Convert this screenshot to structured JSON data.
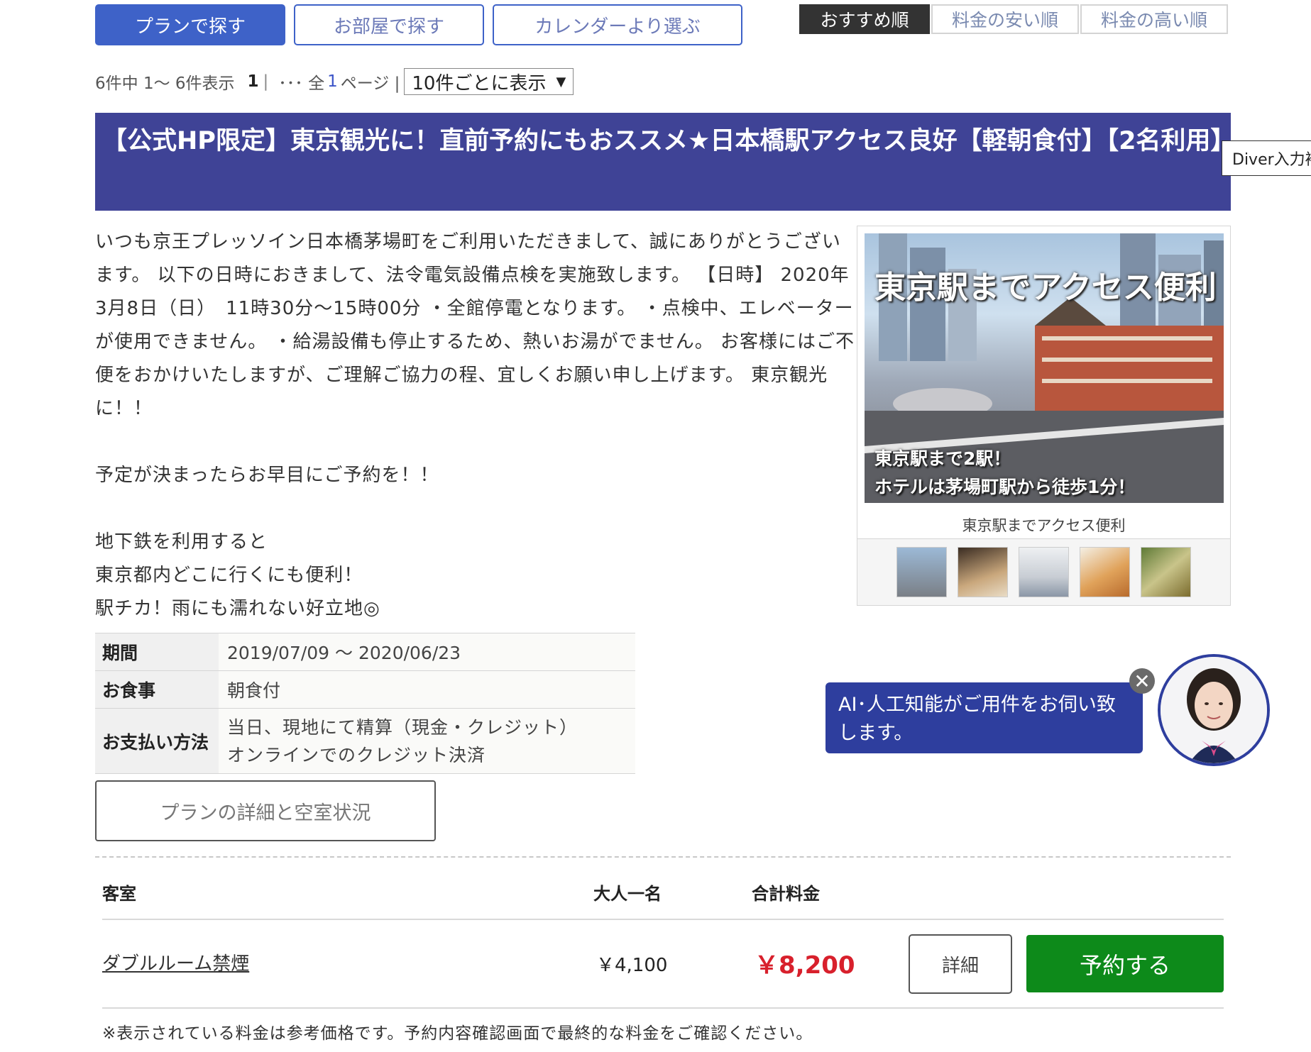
{
  "search_tabs": {
    "plan": "プランで探す",
    "room": "お部屋で探す",
    "calendar": "カレンダーより選ぶ"
  },
  "sort_tabs": {
    "recommended": "おすすめ順",
    "cheap": "料金の安い順",
    "expensive": "料金の高い順"
  },
  "pager": {
    "summary": "6件中 1〜 6件表示",
    "current_page": "1",
    "separator": "|",
    "ellipsis": "･･･ 全",
    "total_pages": "1",
    "page_suffix": "ページ |",
    "per_page": "10件ごとに表示"
  },
  "plan": {
    "title": "【公式HP限定】東京観光に！直前予約にもおススメ★日本橋駅アクセス良好【軽朝食付】【2名利用】",
    "description": [
      "いつも京王プレッソイン日本橋茅場町をご利用いただきまして、誠にありがとうございます。 以下の日時におきまして、法令電気設備点検を実施致します。 【日時】 2020年3月8日（日）　11時30分〜15時00分 ・全館停電となります。 ・点検中、エレベーターが使用できません。 ・給湯設備も停止するため、熱いお湯がでません。 お客様にはご不便をおかけいたしますが、ご理解ご協力の程、宜しくお願い申し上げます。 東京観光に！！",
      "予定が決まったらお早目にご予約を！！",
      "地下鉄を利用すると",
      "東京都内どこに行くにも便利！",
      "駅チカ！雨にも濡れない好立地◎"
    ],
    "photo_title": "東京駅までアクセス便利",
    "photo_sub1": "東京駅まで2駅！",
    "photo_sub2": "ホテルは茅場町駅から徒歩1分！",
    "photo_caption": "東京駅までアクセス便利",
    "info": {
      "period_label": "期間",
      "period_value": "2019/07/09 〜 2020/06/23",
      "meal_label": "お食事",
      "meal_value": "朝食付",
      "payment_label": "お支払い方法",
      "payment_line1": "当日、現地にて精算（現金・クレジット）",
      "payment_line2": "オンラインでのクレジット決済"
    },
    "detail_button": "プランの詳細と空室状況"
  },
  "tooltip": "Diver入力補",
  "rooms": {
    "headers": {
      "room": "客室",
      "adult": "大人一名",
      "total": "合計料金"
    },
    "items": [
      {
        "name": "ダブルルーム禁煙",
        "adult_price": "￥4,100",
        "total_price": "￥8,200",
        "detail": "詳細",
        "reserve": "予約する"
      }
    ],
    "notice": "※表示されている料金は参考価格です。予約内容確認画面で最終的な料金をご確認ください。"
  },
  "chat": {
    "message": "AI･人工知能がご用件をお伺い致します。",
    "close": "✕"
  },
  "colors": {
    "header_bg": "#3f4396",
    "active_tab": "#3e62c8",
    "reserve_green": "#0d8a1a",
    "price_red": "#d8202c",
    "chat_bg": "#2e3e9e"
  }
}
